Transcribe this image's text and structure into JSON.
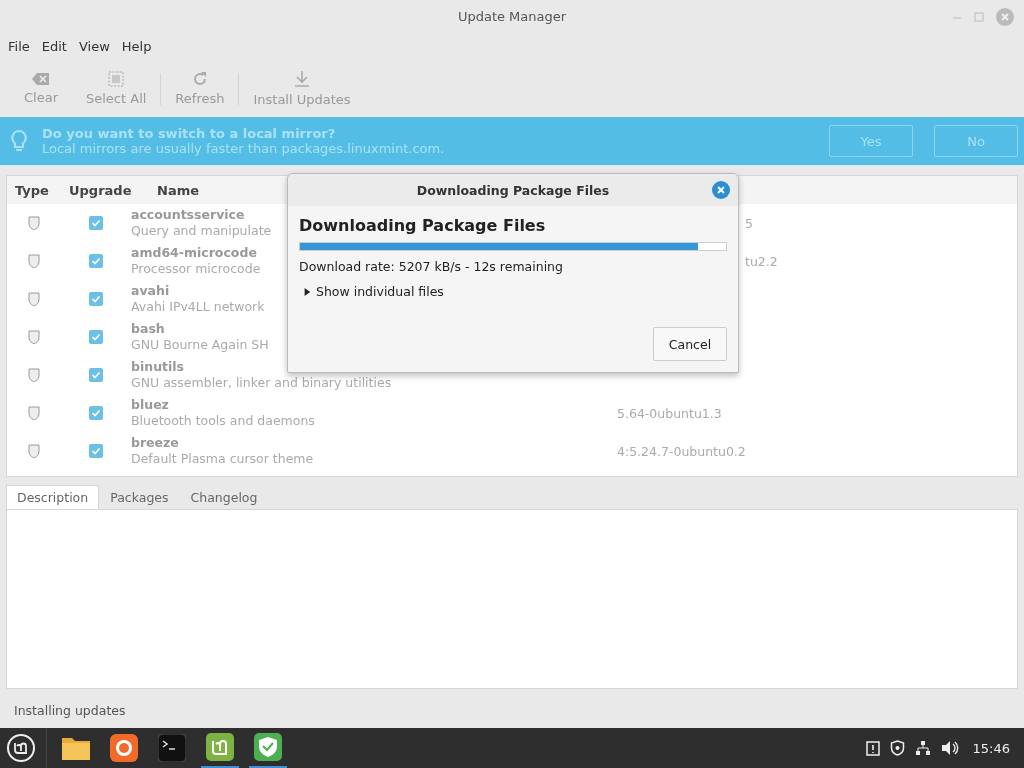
{
  "window": {
    "title": "Update Manager"
  },
  "menu": [
    "File",
    "Edit",
    "View",
    "Help"
  ],
  "toolbar": [
    {
      "kind": "clear",
      "label": "Clear"
    },
    {
      "kind": "select",
      "label": "Select All"
    },
    {
      "kind": "refresh",
      "label": "Refresh"
    },
    {
      "kind": "install",
      "label": "Install Updates"
    }
  ],
  "infobar": {
    "title": "Do you want to switch to a local mirror?",
    "message": "Local mirrors are usually faster than packages.linuxmint.com.",
    "buttons": [
      "Yes",
      "No"
    ]
  },
  "table": {
    "columns": [
      "Type",
      "Upgrade",
      "Name"
    ],
    "rows": [
      {
        "name": "accountsservice",
        "description": "Query and manipulate",
        "version": "5",
        "clipped": true,
        "checked": true
      },
      {
        "name": "amd64-microcode",
        "description": "Processor microcode",
        "version": "tu2.2",
        "clipped": true,
        "checked": true
      },
      {
        "name": "avahi",
        "description": "Avahi IPv4LL network",
        "checked": true
      },
      {
        "name": "bash",
        "description": "GNU Bourne Again SH",
        "checked": true
      },
      {
        "name": "binutils",
        "description": "GNU assembler, linker and binary utilities",
        "checked": true
      },
      {
        "name": "bluez",
        "description": "Bluetooth tools and daemons",
        "version": "5.64-0ubuntu1.3",
        "clipped": false,
        "checked": true
      },
      {
        "name": "breeze",
        "description": "Default Plasma cursor theme",
        "version": "4:5.24.7-0ubuntu0.2",
        "clipped": false,
        "checked": true
      }
    ]
  },
  "details_tabs": [
    {
      "label": "Description",
      "selected": true
    },
    {
      "label": "Packages",
      "selected": false
    },
    {
      "label": "Changelog",
      "selected": false
    }
  ],
  "status_bar": "Installing updates",
  "dialog": {
    "title": "Downloading Package Files",
    "heading": "Downloading Package Files",
    "level": 0.934,
    "rate": "Download rate: 5207 kB/s - 12s remaining",
    "expander": {
      "label": "Show individual files",
      "expanded": false
    },
    "buttons": [
      "Cancel"
    ]
  },
  "taskbar": {
    "apps": [
      {
        "kind": "folder",
        "active": false
      },
      {
        "kind": "browser",
        "active": false
      },
      {
        "kind": "terminal",
        "active": false
      },
      {
        "kind": "mint",
        "active": true
      },
      {
        "kind": "shield",
        "active": true
      }
    ],
    "clock": "15:46"
  }
}
